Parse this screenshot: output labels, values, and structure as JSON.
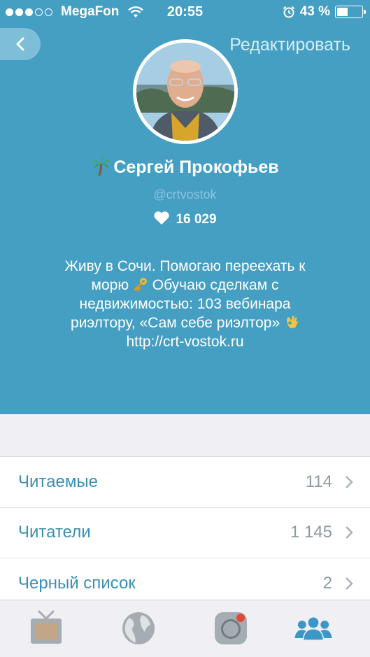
{
  "status_bar": {
    "carrier": "MegaFon",
    "signal_bars": 3,
    "time": "20:55",
    "battery_percent": "43 %",
    "battery_level": 0.43
  },
  "header": {
    "edit_label": "Редактировать"
  },
  "profile": {
    "name": "Сергей Прокофьев",
    "handle": "@crtvostok",
    "likes": "16 029",
    "bio_lines": [
      "Живу в Сочи. Помогаю переехать к",
      "морю",
      "Обучаю сделкам с",
      "недвижимостью: 103 вебинара",
      "риэлтору, «Сам себе риэлтор»",
      "http://crt-vostok.ru"
    ]
  },
  "lists": [
    {
      "label": "Читаемые",
      "count": "114"
    },
    {
      "label": "Читатели",
      "count": "1 145"
    },
    {
      "label": "Черный список",
      "count": "2"
    }
  ],
  "tabs": [
    "tv-icon",
    "globe-icon",
    "camera-icon",
    "people-icon"
  ],
  "colors": {
    "profile_bg": "#449fc3",
    "list_label": "#3a8fb3",
    "active_tab": "#3b97c8",
    "inactive_tab": "#a5adb2"
  }
}
